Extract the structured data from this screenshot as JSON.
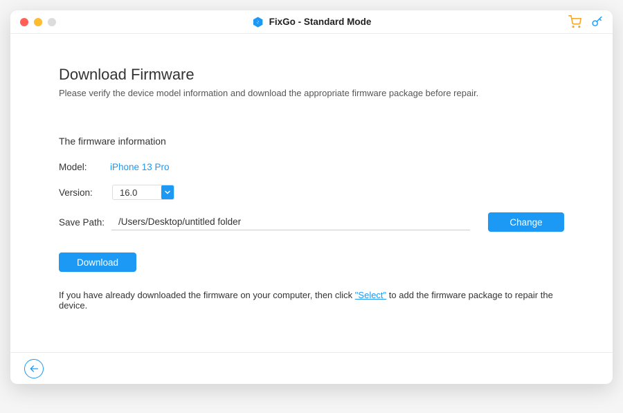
{
  "titlebar": {
    "title": "FixGo - Standard Mode"
  },
  "page": {
    "title": "Download Firmware",
    "subtitle": "Please verify the device model information and download the appropriate firmware package before repair."
  },
  "firmware": {
    "section_label": "The firmware information",
    "model_label": "Model:",
    "model_value": "iPhone 13 Pro",
    "version_label": "Version:",
    "version_value": "16.0",
    "savepath_label": "Save Path:",
    "savepath_value": "/Users/Desktop/untitled folder",
    "change_label": "Change",
    "download_label": "Download"
  },
  "footer": {
    "prefix": "If you have already downloaded the firmware on your computer, then click ",
    "select_label": "\"Select\"",
    "suffix": " to add the firmware package to repair the device."
  }
}
